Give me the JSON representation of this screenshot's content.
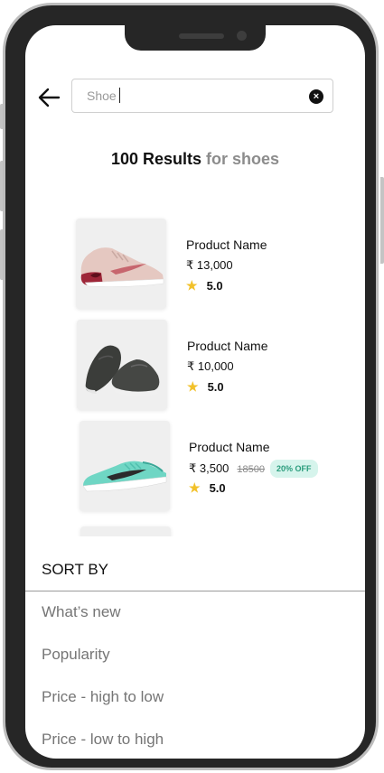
{
  "search": {
    "value": "Shoe",
    "clear_icon": "close-circle-icon",
    "back_icon": "arrow-left-icon"
  },
  "results": {
    "count": "100 Results",
    "query": "for shoes"
  },
  "products": [
    {
      "name": "Product Name",
      "price": "₹ 13,000",
      "rating": "5.0"
    },
    {
      "name": "Product Name",
      "price": "₹ 10,000",
      "rating": "5.0"
    },
    {
      "name": "Product Name",
      "price": "₹ 3,500",
      "old_price": "18500",
      "discount": "20% OFF",
      "rating": "5.0"
    }
  ],
  "sort": {
    "title": "SORT BY",
    "options": [
      "What’s new",
      "Popularity",
      "Price - high to low",
      "Price - low to high"
    ]
  },
  "colors": {
    "star": "#f2c12a",
    "badge_bg": "#d6f4ec",
    "badge_text": "#2a9c7c",
    "frame": "#262626"
  }
}
